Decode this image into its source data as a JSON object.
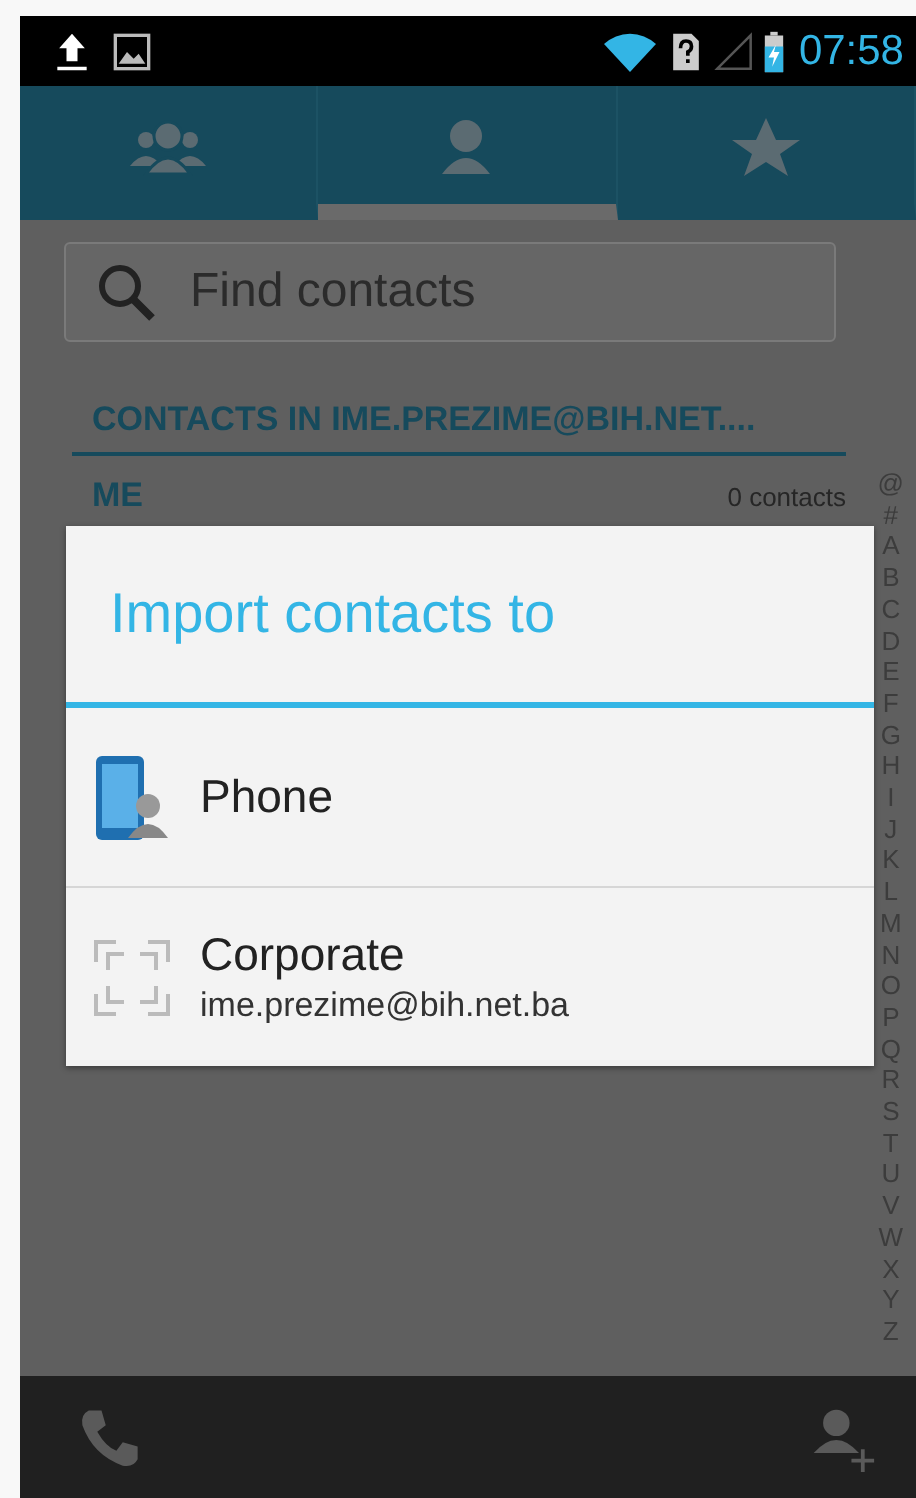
{
  "status_bar": {
    "time": "07:58"
  },
  "tabs": [
    {
      "kind": "groups",
      "selected": false
    },
    {
      "kind": "person",
      "selected": true
    },
    {
      "kind": "star",
      "selected": false
    }
  ],
  "search": {
    "placeholder": "Find contacts"
  },
  "section_header": "CONTACTS IN IME.PREZIME@BIH.NET....",
  "me_row": {
    "label": "ME",
    "count": "0 contacts"
  },
  "index_letters": [
    "@",
    "#",
    "A",
    "B",
    "C",
    "D",
    "E",
    "F",
    "G",
    "H",
    "I",
    "J",
    "K",
    "L",
    "M",
    "N",
    "O",
    "P",
    "Q",
    "R",
    "S",
    "T",
    "U",
    "V",
    "W",
    "X",
    "Y",
    "Z"
  ],
  "dialog": {
    "title": "Import contacts to",
    "options": [
      {
        "kind": "phone",
        "label": "Phone"
      },
      {
        "kind": "corporate",
        "label": "Corporate",
        "sublabel": "ime.prezime@bih.net.ba"
      }
    ]
  }
}
